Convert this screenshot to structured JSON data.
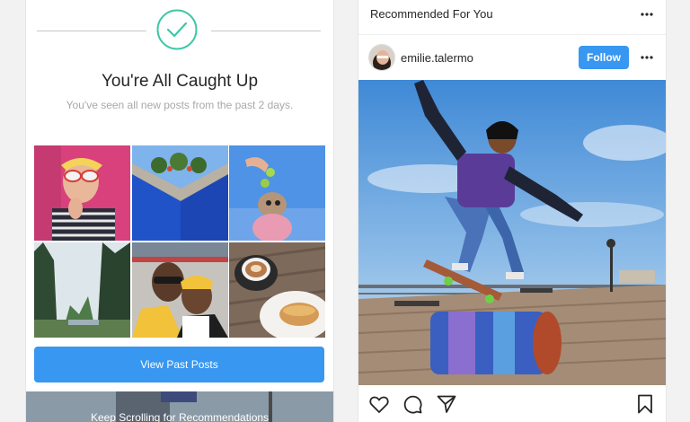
{
  "caught_up": {
    "title": "You're All Caught Up",
    "subtitle": "You've seen all new posts from the past 2 days.",
    "view_past_label": "View Past Posts",
    "keep_scrolling_label": "Keep Scrolling for Recommendations"
  },
  "recommended": {
    "title": "Recommended For You",
    "post": {
      "username": "emilie.talermo",
      "follow_label": "Follow"
    }
  },
  "colors": {
    "accent": "#3897f0",
    "check_green": "#3fc7a6"
  },
  "icons": [
    "check-icon",
    "more-icon",
    "heart-icon",
    "comment-icon",
    "share-icon",
    "bookmark-icon"
  ]
}
